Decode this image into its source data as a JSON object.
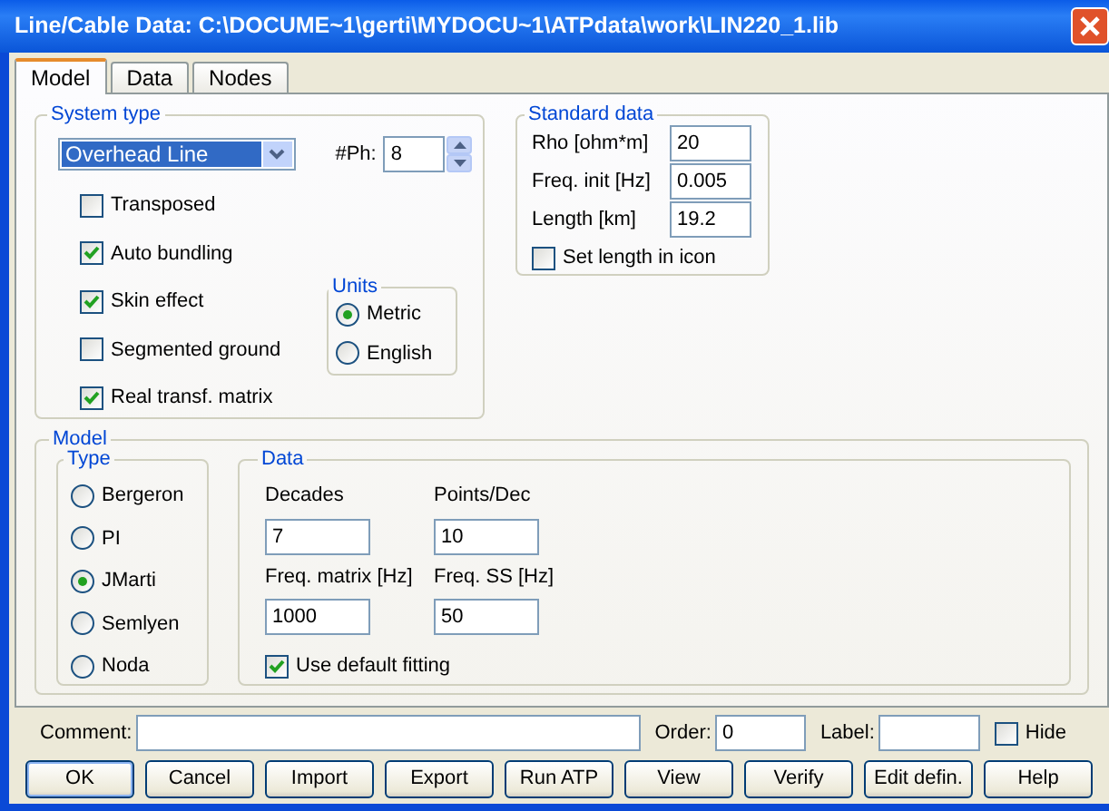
{
  "window": {
    "title": "Line/Cable Data: C:\\DOCUME~1\\gerti\\MYDOCU~1\\ATPdata\\work\\LIN220_1.lib"
  },
  "tabs": [
    {
      "label": "Model",
      "selected": true
    },
    {
      "label": "Data",
      "selected": false
    },
    {
      "label": "Nodes",
      "selected": false
    }
  ],
  "system_type": {
    "title": "System type",
    "type_select": "Overhead Line",
    "phases_label": "#Ph:",
    "phases": "8",
    "options": [
      {
        "label": "Transposed",
        "checked": false
      },
      {
        "label": "Auto bundling",
        "checked": true
      },
      {
        "label": "Skin effect",
        "checked": true
      },
      {
        "label": "Segmented ground",
        "checked": false
      },
      {
        "label": "Real transf. matrix",
        "checked": true
      }
    ],
    "units": {
      "title": "Units",
      "options": [
        {
          "label": "Metric",
          "selected": true
        },
        {
          "label": "English",
          "selected": false
        }
      ]
    }
  },
  "standard_data": {
    "title": "Standard data",
    "fields": [
      {
        "label": "Rho [ohm*m]",
        "value": "20"
      },
      {
        "label": "Freq. init [Hz]",
        "value": "0.005"
      },
      {
        "label": "Length [km]",
        "value": "19.2"
      }
    ],
    "set_length": {
      "label": "Set length in icon",
      "checked": false
    }
  },
  "model": {
    "title": "Model",
    "type": {
      "title": "Type",
      "options": [
        {
          "label": "Bergeron",
          "selected": false
        },
        {
          "label": "PI",
          "selected": false
        },
        {
          "label": "JMarti",
          "selected": true
        },
        {
          "label": "Semlyen",
          "selected": false
        },
        {
          "label": "Noda",
          "selected": false
        }
      ]
    },
    "data": {
      "title": "Data",
      "fields": [
        {
          "label": "Decades",
          "value": "7"
        },
        {
          "label": "Points/Dec",
          "value": "10"
        },
        {
          "label": "Freq. matrix [Hz]",
          "value": "1000"
        },
        {
          "label": "Freq. SS [Hz]",
          "value": "50"
        }
      ],
      "default_fitting": {
        "label": "Use default fitting",
        "checked": true
      }
    }
  },
  "footer": {
    "fields": [
      {
        "label": "Comment:"
      },
      {
        "label": "Order:",
        "value": "0"
      },
      {
        "label": "Label:"
      }
    ],
    "hide": {
      "label": "Hide",
      "checked": false
    }
  },
  "buttons": [
    "OK",
    "Cancel",
    "Import",
    "Export",
    "Run ATP",
    "View",
    "Verify",
    "Edit defin.",
    "Help"
  ]
}
